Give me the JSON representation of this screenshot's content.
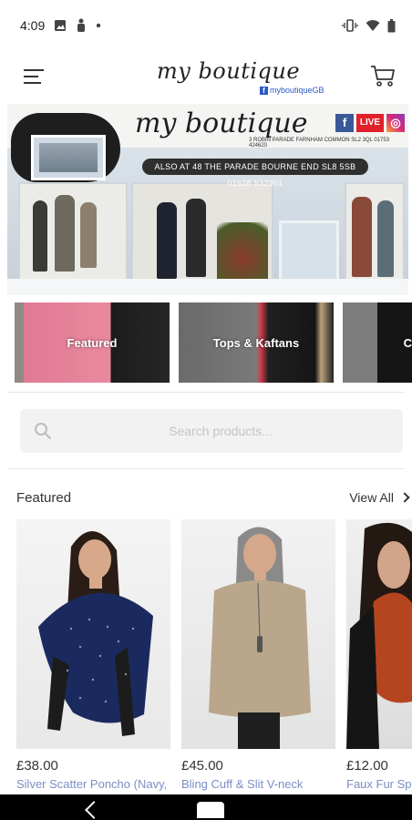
{
  "status_bar": {
    "time": "4:09"
  },
  "header": {
    "brand": "my boutique",
    "social_handle": "myboutiqueGB"
  },
  "hero": {
    "title": "my boutique",
    "address_small": "3 ROBIN PARADE FARNHAM COMMON SL2 3QL  01753 424620",
    "address_banner": "ALSO AT 48 THE PARADE BOURNE END SL8 5SB   01628 532901",
    "live_label": "LIVE"
  },
  "categories": [
    {
      "label": "Featured"
    },
    {
      "label": "Tops & Kaftans"
    },
    {
      "label": "C"
    }
  ],
  "search": {
    "placeholder": "Search products..."
  },
  "featured": {
    "title": "Featured",
    "view_all": "View All",
    "products": [
      {
        "price": "£38.00",
        "name": "Silver Scatter Poncho (Navy,"
      },
      {
        "price": "£45.00",
        "name": "Bling Cuff & Slit V-neck"
      },
      {
        "price": "£12.00",
        "name": "Faux Fur Spri"
      }
    ]
  },
  "colors": {
    "link": "#7a8fc4",
    "facebook": "#3b5998",
    "live": "#e0202a"
  }
}
